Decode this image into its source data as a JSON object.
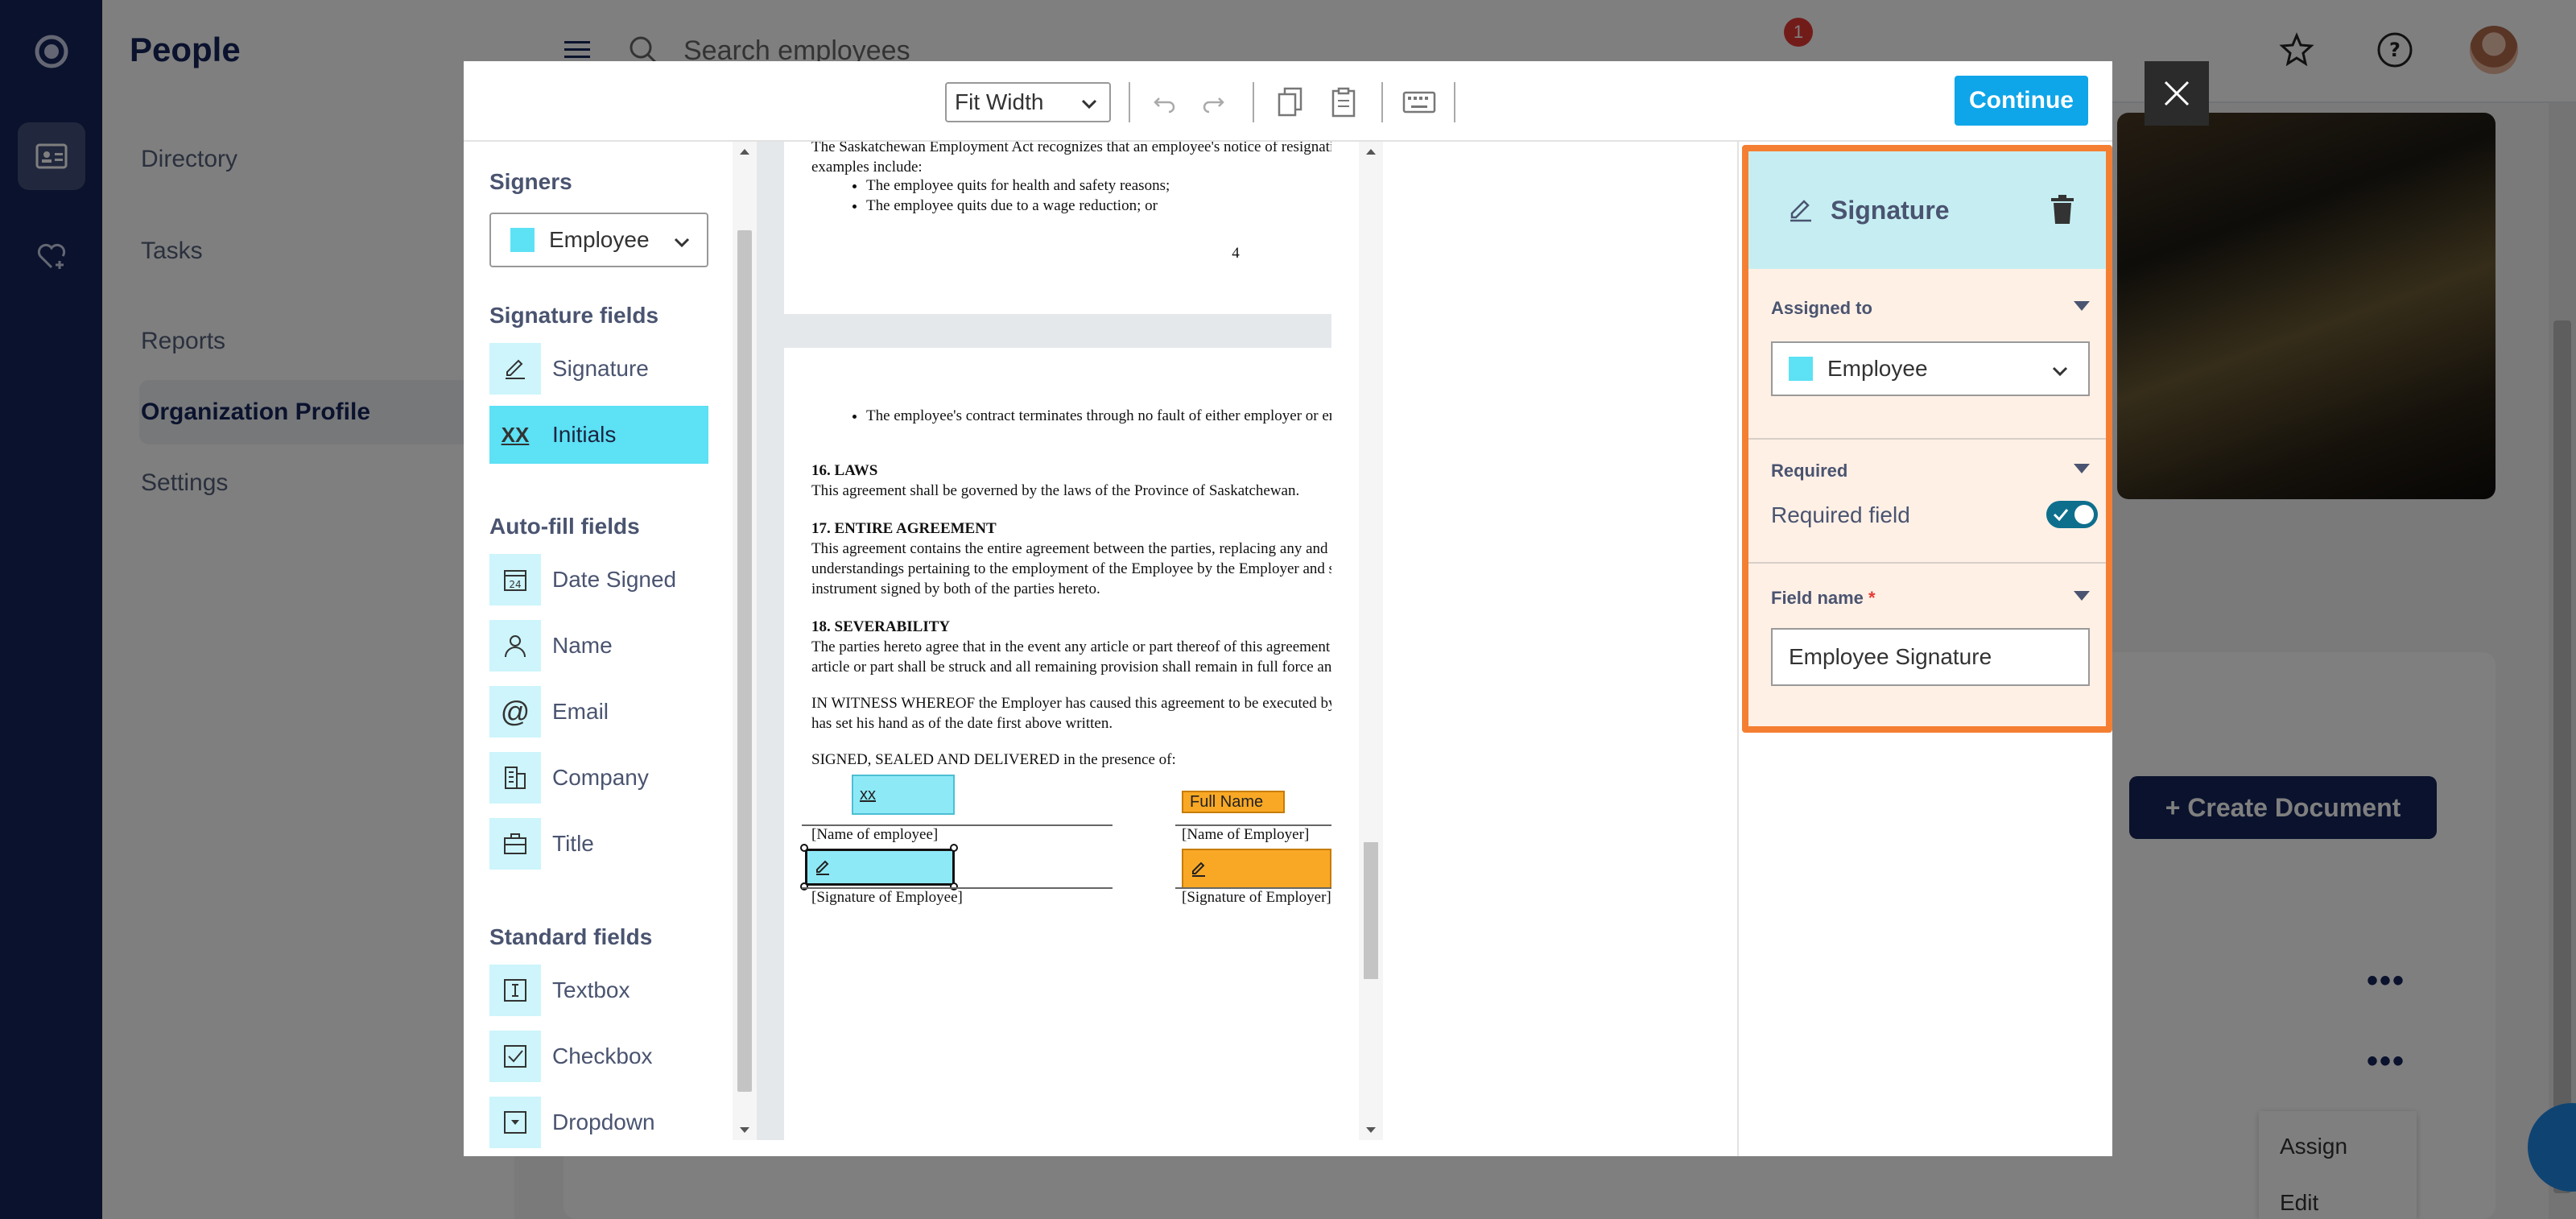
{
  "app": {
    "section_title": "People",
    "nav": [
      "Directory",
      "Tasks",
      "Reports",
      "Organization Profile",
      "Settings"
    ],
    "search_placeholder": "Search employees",
    "notification_count": "1",
    "create_document_label": "+ Create Document",
    "context_menu": [
      "Assign",
      "Edit"
    ]
  },
  "modal": {
    "toolbar": {
      "zoom": "Fit Width",
      "continue_label": "Continue",
      "icons": [
        "undo-icon",
        "redo-icon",
        "copy-icon",
        "paste-icon",
        "keyboard-icon"
      ]
    },
    "left_panel": {
      "signers_heading": "Signers",
      "signer_selected": "Employee",
      "signature_fields_heading": "Signature fields",
      "signature_fields": [
        {
          "label": "Signature",
          "icon": "pen-icon"
        },
        {
          "label": "Initials",
          "icon": "xx",
          "active": true
        }
      ],
      "autofill_heading": "Auto-fill fields",
      "autofill_fields": [
        {
          "label": "Date Signed",
          "icon": "calendar-icon"
        },
        {
          "label": "Name",
          "icon": "person-icon"
        },
        {
          "label": "Email",
          "icon": "at-icon"
        },
        {
          "label": "Company",
          "icon": "building-icon"
        },
        {
          "label": "Title",
          "icon": "briefcase-icon"
        }
      ],
      "standard_heading": "Standard fields",
      "standard_fields": [
        {
          "label": "Textbox",
          "icon": "textbox-icon"
        },
        {
          "label": "Checkbox",
          "icon": "checkbox-icon"
        },
        {
          "label": "Dropdown",
          "icon": "dropdown-icon"
        }
      ]
    },
    "document": {
      "page1_top_text": "The Saskatchewan Employment Act recognizes that an employee's notice of resignation is not appropriate in all situations. Some examples include:",
      "page1_bullets": [
        "The employee quits for health and safety reasons;",
        "The employee quits due to a wage reduction; or"
      ],
      "page_number": "4",
      "page2_bullet": "The employee's contract terminates through no fault of either employer or employee (e.g., fire destroys business).",
      "s16_title": "16. LAWS",
      "s16_text": "This agreement shall be governed by the laws of the Province of Saskatchewan.",
      "s17_title": "17. ENTIRE AGREEMENT",
      "s17_text": "This agreement contains the entire agreement between the parties, replacing any and all prior oral or written agreements or understandings pertaining to the employment of the Employee by the Employer and shall be amended or modified only by written instrument signed by both of the parties hereto.",
      "s18_title": "18. SEVERABILITY",
      "s18_text": "The parties hereto agree that in the event any article or part thereof of this agreement is held to be unenforceable or invalid then said article or part shall be struck and all remaining provision shall remain in full force and effect.",
      "witness_text": "IN WITNESS WHEREOF the Employer has caused this agreement to be executed by its duly authorized officers and the Employee has set his hand as of the date first above written.",
      "signed_text": "SIGNED, SEALED AND DELIVERED in the presence of:",
      "initials_box": "xx",
      "fullname_box": "Full Name",
      "name_of_employee": "[Name of employee]",
      "name_of_employer": "[Name of Employer]",
      "sig_of_employee": "[Signature of Employee]",
      "sig_of_employer": "[Signature of Employer]"
    },
    "properties": {
      "title": "Signature",
      "assigned_to_label": "Assigned to",
      "assigned_to_value": "Employee",
      "required_label": "Required",
      "required_field_label": "Required field",
      "required_on": true,
      "field_name_label": "Field name",
      "field_name_required_mark": "*",
      "field_name_value": "Employee Signature"
    },
    "colors": {
      "employee": "#5ce1f5",
      "employer": "#f9a825",
      "selection_border": "#f47f32",
      "continue": "#0ea5e9"
    }
  }
}
